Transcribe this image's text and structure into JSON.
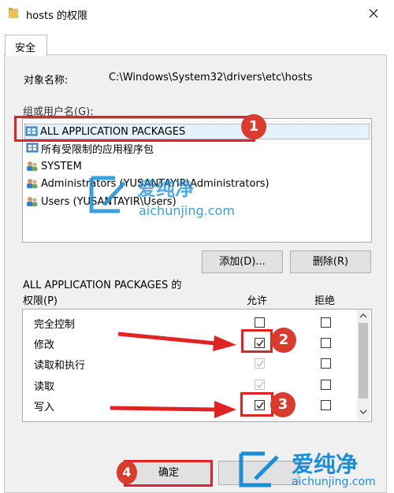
{
  "window": {
    "title": "hosts 的权限",
    "close_glyph": "✕"
  },
  "tabs": [
    {
      "label": "安全"
    }
  ],
  "object": {
    "label": "对象名称:",
    "value": "C:\\Windows\\System32\\drivers\\etc\\hosts"
  },
  "groups": {
    "label": "组或用户名(G):",
    "items": [
      {
        "label": "ALL APPLICATION PACKAGES",
        "icon": "app-package-icon",
        "selected": true
      },
      {
        "label": "所有受限制的应用程序包",
        "icon": "app-package-icon",
        "selected": false
      },
      {
        "label": "SYSTEM",
        "icon": "users-group-icon",
        "selected": false
      },
      {
        "label": "Administrators (YUSANTAYIR\\Administrators)",
        "icon": "users-group-icon",
        "selected": false
      },
      {
        "label": "Users (YUSANTAYIR\\Users)",
        "icon": "users-group-icon",
        "selected": false
      }
    ]
  },
  "buttons": {
    "add": "添加(D)...",
    "remove": "删除(R)",
    "ok": "确定",
    "cancel": ""
  },
  "permissions": {
    "title_line1": "ALL APPLICATION PACKAGES 的",
    "title_line2": "权限(P)",
    "allow_header": "允许",
    "deny_header": "拒绝",
    "rows": [
      {
        "label": "完全控制",
        "allow": false,
        "allow_disabled": false,
        "deny": false
      },
      {
        "label": "修改",
        "allow": true,
        "allow_disabled": false,
        "deny": false
      },
      {
        "label": "读取和执行",
        "allow": true,
        "allow_disabled": true,
        "deny": false
      },
      {
        "label": "读取",
        "allow": true,
        "allow_disabled": true,
        "deny": false
      },
      {
        "label": "写入",
        "allow": true,
        "allow_disabled": false,
        "deny": false
      }
    ]
  },
  "annotations": {
    "badges": [
      "1",
      "2",
      "3",
      "4"
    ],
    "color": "#e02424"
  },
  "watermark": {
    "brand": "爱纯净",
    "url": "aichunjing.com",
    "color": "#1a8fd8"
  }
}
